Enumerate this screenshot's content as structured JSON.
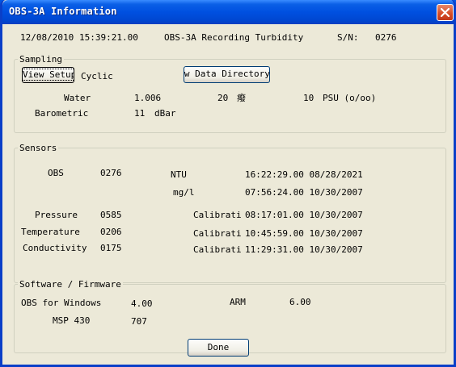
{
  "window": {
    "title": "OBS-3A Information"
  },
  "header": {
    "date": "12/08/2010",
    "time": "15:39:21.00",
    "description": "OBS-3A Recording Turbidity",
    "sn_label": "S/N:",
    "sn_value": "0276"
  },
  "sampling": {
    "legend": "Sampling",
    "view_setup_label": "View Setup",
    "mode": "Cyclic",
    "view_data_dir_label": "View Data Directory",
    "water_label": "Water",
    "water_value": "1.006",
    "temp_value": "20",
    "temp_unit": "癈",
    "salinity_value": "10",
    "salinity_unit": "PSU (o/oo)",
    "barometric_label": "Barometric",
    "barometric_value": "11",
    "barometric_unit": "dBar"
  },
  "sensors": {
    "legend": "Sensors",
    "obs_label": "OBS",
    "obs_sn": "0276",
    "ntu_label": "NTU",
    "ntu_cal": "16:22:29.00 08/28/2021",
    "mgl_label": "mg/l",
    "mgl_cal": "07:56:24.00 10/30/2007",
    "rows": [
      {
        "label": "Pressure",
        "sn": "0585",
        "cal_label": "Calibrati",
        "cal": "08:17:01.00 10/30/2007"
      },
      {
        "label": "Temperature",
        "sn": "0206",
        "cal_label": "Calibrati",
        "cal": "10:45:59.00 10/30/2007"
      },
      {
        "label": "Conductivity",
        "sn": "0175",
        "cal_label": "Calibrati",
        "cal": "11:29:31.00 10/30/2007"
      }
    ]
  },
  "firmware": {
    "legend": "Software / Firmware",
    "obs_windows_label": "OBS for Windows",
    "obs_windows_value": "4.00",
    "arm_label": "ARM",
    "arm_value": "6.00",
    "msp_label": "MSP 430",
    "msp_value": "707"
  },
  "footer": {
    "done_label": "Done"
  }
}
